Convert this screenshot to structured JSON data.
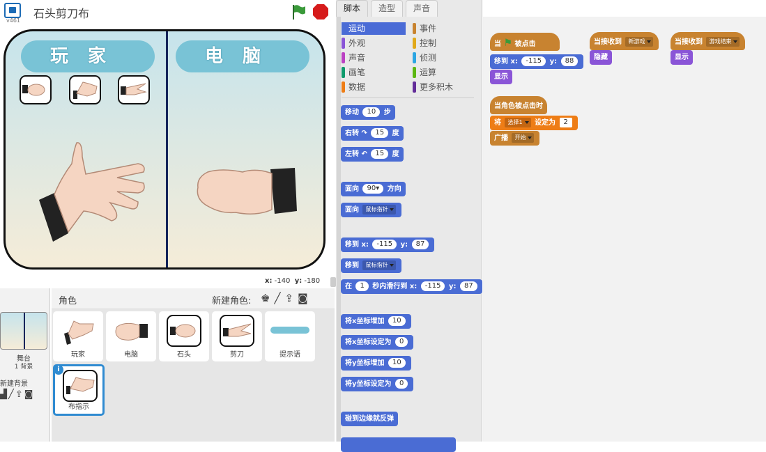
{
  "stage_header": {
    "title": "石头剪刀布",
    "version": "v461"
  },
  "stage": {
    "player_label": "玩家",
    "computer_label": "电脑",
    "coords": {
      "x_label": "x:",
      "x": "-140",
      "y_label": "y:",
      "y": "-180"
    }
  },
  "sprites_panel": {
    "header": "角色",
    "new_sprite_label": "新建角色:",
    "stage_item": {
      "label": "舞台",
      "backdrops": "1 背景"
    },
    "new_backdrop_label": "新建背景",
    "sprites": [
      {
        "name": "玩家"
      },
      {
        "name": "电脑"
      },
      {
        "name": "石头"
      },
      {
        "name": "剪刀"
      },
      {
        "name": "提示语"
      },
      {
        "name": "布指示",
        "selected": true
      }
    ]
  },
  "tabs": [
    "脚本",
    "造型",
    "声音"
  ],
  "categories": [
    {
      "label": "运动",
      "color": "#4a6cd4",
      "selected": true
    },
    {
      "label": "事件",
      "color": "#c88330"
    },
    {
      "label": "外观",
      "color": "#8a55d7"
    },
    {
      "label": "控制",
      "color": "#e1a91a"
    },
    {
      "label": "声音",
      "color": "#bb42c3"
    },
    {
      "label": "侦测",
      "color": "#2ca5e2"
    },
    {
      "label": "画笔",
      "color": "#0e9a6c"
    },
    {
      "label": "运算",
      "color": "#5cb712"
    },
    {
      "label": "数据",
      "color": "#ee7d16"
    },
    {
      "label": "更多积木",
      "color": "#632d99"
    }
  ],
  "palette_blocks": {
    "move": {
      "pre": "移动",
      "val": "10",
      "post": "步"
    },
    "turn_right": {
      "pre": "右转",
      "val": "15",
      "post": "度"
    },
    "turn_left": {
      "pre": "左转",
      "val": "15",
      "post": "度"
    },
    "point_dir": {
      "pre": "面向",
      "val": "90▾",
      "post": "方向"
    },
    "point_towards": {
      "pre": "面向",
      "dd": "鼠标指针"
    },
    "goto_xy": {
      "pre": "移到 x:",
      "x": "-115",
      "mid": "y:",
      "y": "87"
    },
    "goto": {
      "pre": "移到",
      "dd": "鼠标指针"
    },
    "glide": {
      "pre": "在",
      "secs": "1",
      "mid": "秒内滑行到 x:",
      "x": "-115",
      "ylab": "y:",
      "y": "87"
    },
    "change_x": {
      "pre": "将x坐标增加",
      "val": "10"
    },
    "set_x": {
      "pre": "将x坐标设定为",
      "val": "0"
    },
    "change_y": {
      "pre": "将y坐标增加",
      "val": "10"
    },
    "set_y": {
      "pre": "将y坐标设定为",
      "val": "0"
    },
    "bounce": {
      "pre": "碰到边缘就反弹"
    }
  },
  "scripts": {
    "s1_hat": {
      "pre": "当",
      "post": "被点击"
    },
    "s1_goto": {
      "pre": "移到 x:",
      "x": "-115",
      "mid": "y:",
      "y": "88"
    },
    "s1_show": "显示",
    "s2_hat": {
      "pre": "当接收到",
      "dd": "新游戏"
    },
    "s2_hide": "隐藏",
    "s3_hat": {
      "pre": "当接收到",
      "dd": "游戏结束"
    },
    "s3_show": "显示",
    "s4_hat": "当角色被点击时",
    "s4_set": {
      "pre": "将",
      "dd": "选择1",
      "mid": "设定为",
      "val": "2"
    },
    "s4_bcast": {
      "pre": "广播",
      "dd": "开始"
    }
  },
  "colors": {
    "motion": "#4a6cd4",
    "events": "#c88330",
    "looks": "#8a55d7",
    "data": "#ee7d16",
    "green_flag": "#2a8a2a",
    "stop": "#d61b1b"
  }
}
